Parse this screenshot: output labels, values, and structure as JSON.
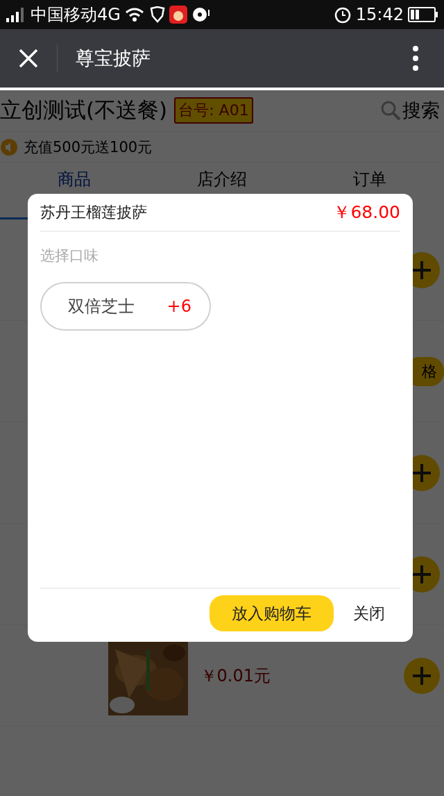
{
  "status_bar": {
    "carrier": "中国移动4G",
    "time": "15:42"
  },
  "nav_bar": {
    "title": "尊宝披萨"
  },
  "store": {
    "name": "立创测试(不送餐)",
    "table_badge": "台号: A01",
    "search": "搜索"
  },
  "notice": "充值500元送100元",
  "tabs": [
    {
      "label": "商品",
      "selected": true
    },
    {
      "label": "店介绍",
      "selected": false
    },
    {
      "label": "订单",
      "selected": false
    }
  ],
  "products": [
    {
      "kind": "add"
    },
    {
      "kind": "spec",
      "action": "格"
    },
    {
      "kind": "add"
    },
    {
      "kind": "add"
    },
    {
      "kind": "add",
      "price": "￥0.01元"
    }
  ],
  "dialog": {
    "title": "苏丹王榴莲披萨",
    "price": "￥68.00",
    "section": "选择口味",
    "options": [
      {
        "label": "双倍芝士",
        "extra": "+6",
        "selected": false
      }
    ],
    "add_to_cart": "放入购物车",
    "close": "关闭"
  }
}
